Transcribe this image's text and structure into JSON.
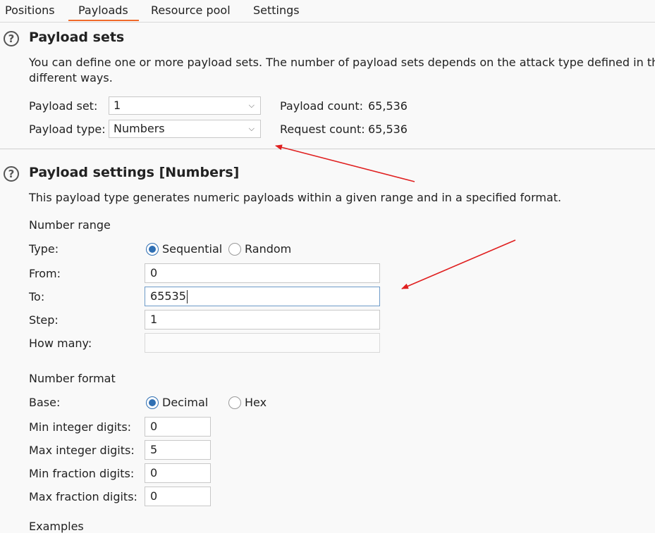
{
  "tabs": [
    {
      "label": "Positions"
    },
    {
      "label": "Payloads"
    },
    {
      "label": "Resource pool"
    },
    {
      "label": "Settings"
    }
  ],
  "payload_sets": {
    "title": "Payload sets",
    "description_line1": "You can define one or more payload sets. The number of payload sets depends on the attack type defined in the P",
    "description_line2": "different ways.",
    "payload_set_label": "Payload set:",
    "payload_set_value": "1",
    "payload_type_label": "Payload type:",
    "payload_type_value": "Numbers",
    "payload_count_label": "Payload count:",
    "payload_count_value": "65,536",
    "request_count_label": "Request count:",
    "request_count_value": "65,536"
  },
  "payload_settings": {
    "title": "Payload settings [Numbers]",
    "description": "This payload type generates numeric payloads within a given range and in a specified format.",
    "number_range": {
      "heading": "Number range",
      "type_label": "Type:",
      "type_options": [
        "Sequential",
        "Random"
      ],
      "type_selected": "Sequential",
      "from_label": "From:",
      "from_value": "0",
      "to_label": "To:",
      "to_value": "65535",
      "step_label": "Step:",
      "step_value": "1",
      "how_many_label": "How many:",
      "how_many_value": ""
    },
    "number_format": {
      "heading": "Number format",
      "base_label": "Base:",
      "base_options": [
        "Decimal",
        "Hex"
      ],
      "base_selected": "Decimal",
      "min_int_label": "Min integer digits:",
      "min_int_value": "0",
      "max_int_label": "Max integer digits:",
      "max_int_value": "5",
      "min_frac_label": "Min fraction digits:",
      "min_frac_value": "0",
      "max_frac_label": "Max fraction digits:",
      "max_frac_value": "0"
    },
    "examples_heading": "Examples"
  },
  "colors": {
    "accent_tab": "#f06a2a",
    "radio_selected": "#2f6fb3",
    "annotation_arrow": "#e02020"
  },
  "icons": {
    "help": "question-circle-icon",
    "dropdown": "chevron-down-icon"
  }
}
